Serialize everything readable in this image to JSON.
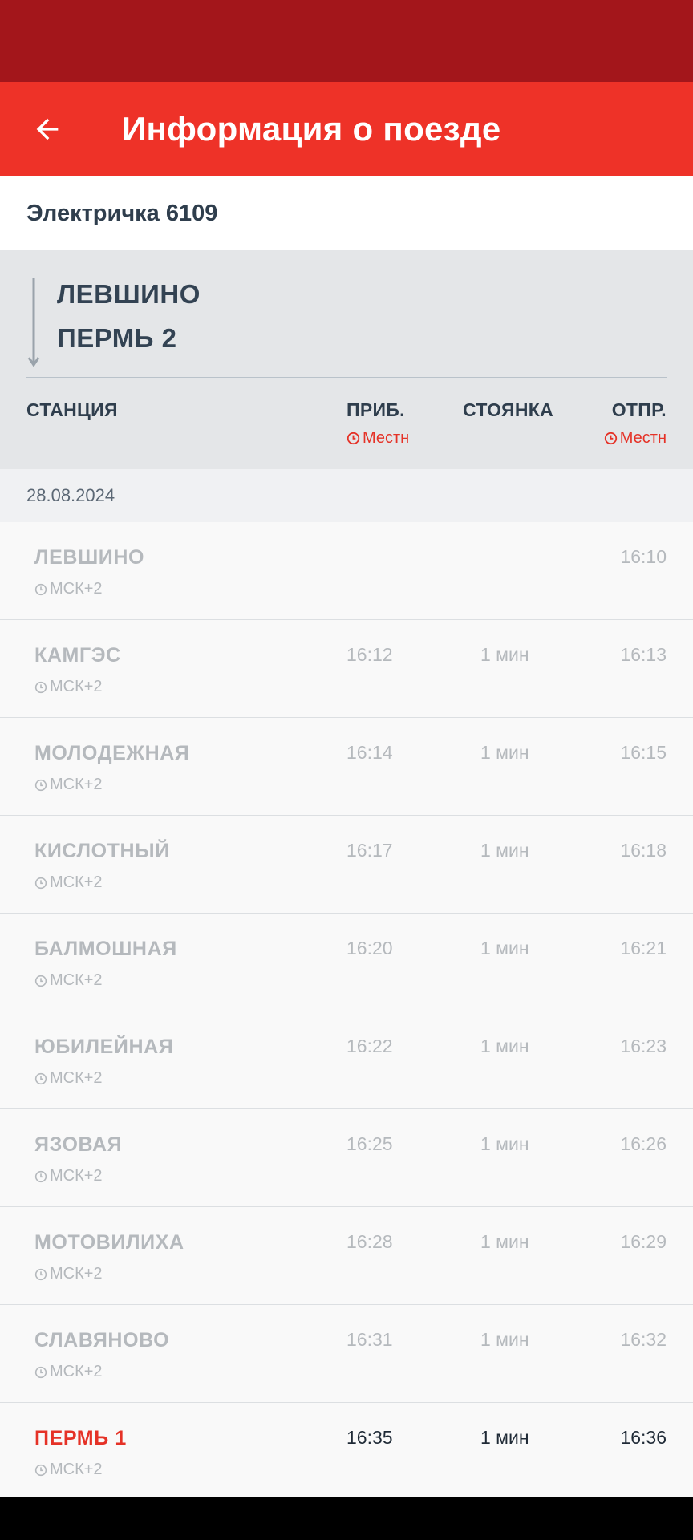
{
  "colors": {
    "status_bar": "#a3161b",
    "app_bar": "#ee3228",
    "accent_red": "#e53227",
    "text_dark": "#2f3e4d",
    "text_muted": "#b5b9bd"
  },
  "header": {
    "back_icon": "arrow-back-icon",
    "title": "Информация о поезде"
  },
  "train": {
    "name": "Электричка 6109"
  },
  "route": {
    "from": "ЛЕВШИНО",
    "to": "ПЕРМЬ 2"
  },
  "columns": {
    "station": "СТАНЦИЯ",
    "arrival": "ПРИБ.",
    "stop": "СТОЯНКА",
    "departure": "ОТПР.",
    "arrival_tz": "Местн",
    "departure_tz": "Местн",
    "tz_icon": "clock-icon"
  },
  "date": "28.08.2024",
  "stations": [
    {
      "name": "ЛЕВШИНО",
      "tz": "МСК+2",
      "arrival": "",
      "stop": "",
      "departure": "16:10",
      "current": false
    },
    {
      "name": "КАМГЭС",
      "tz": "МСК+2",
      "arrival": "16:12",
      "stop": "1 мин",
      "departure": "16:13",
      "current": false
    },
    {
      "name": "МОЛОДЕЖНАЯ",
      "tz": "МСК+2",
      "arrival": "16:14",
      "stop": "1 мин",
      "departure": "16:15",
      "current": false
    },
    {
      "name": "КИСЛОТНЫЙ",
      "tz": "МСК+2",
      "arrival": "16:17",
      "stop": "1 мин",
      "departure": "16:18",
      "current": false
    },
    {
      "name": "БАЛМОШНАЯ",
      "tz": "МСК+2",
      "arrival": "16:20",
      "stop": "1 мин",
      "departure": "16:21",
      "current": false
    },
    {
      "name": "ЮБИЛЕЙНАЯ",
      "tz": "МСК+2",
      "arrival": "16:22",
      "stop": "1 мин",
      "departure": "16:23",
      "current": false
    },
    {
      "name": "ЯЗОВАЯ",
      "tz": "МСК+2",
      "arrival": "16:25",
      "stop": "1 мин",
      "departure": "16:26",
      "current": false
    },
    {
      "name": "МОТОВИЛИХА",
      "tz": "МСК+2",
      "arrival": "16:28",
      "stop": "1 мин",
      "departure": "16:29",
      "current": false
    },
    {
      "name": "СЛАВЯНОВО",
      "tz": "МСК+2",
      "arrival": "16:31",
      "stop": "1 мин",
      "departure": "16:32",
      "current": false
    },
    {
      "name": "ПЕРМЬ 1",
      "tz": "МСК+2",
      "arrival": "16:35",
      "stop": "1 мин",
      "departure": "16:36",
      "current": true
    }
  ]
}
